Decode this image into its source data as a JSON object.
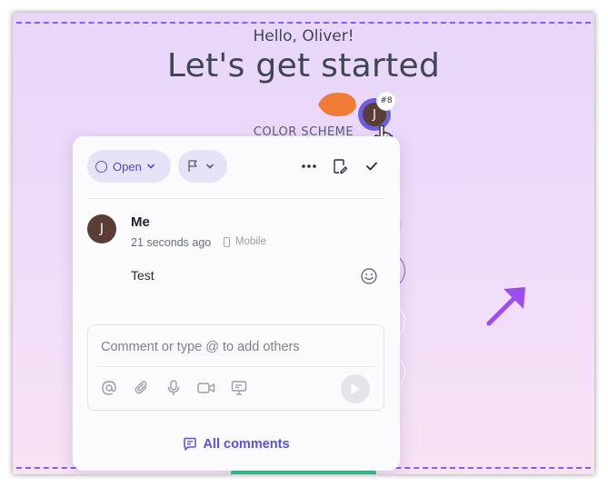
{
  "page": {
    "greeting": "Hello, Oliver!",
    "headline": "Let's get started",
    "section_label": "COLOR SCHEME"
  },
  "collaborator": {
    "initial": "J",
    "badge": "#8",
    "pin_color": "#f07b34",
    "ring_color": "#6d5fe0"
  },
  "comment_panel": {
    "status_label": "Open",
    "comment": {
      "author_initial": "J",
      "author": "Me",
      "time": "21 seconds ago",
      "device": "Mobile",
      "text": "Test"
    },
    "composer": {
      "placeholder": "Comment or type @ to add others",
      "icons": [
        "mention-icon",
        "attachment-icon",
        "microphone-icon",
        "video-icon",
        "screen-record-icon"
      ]
    },
    "all_comments_label": "All comments"
  },
  "colors": {
    "accent": "#5a52d8",
    "accent_bg": "#e6e3f8",
    "dash_border": "#8b5cf6",
    "arrow": "#9b4ef0"
  }
}
